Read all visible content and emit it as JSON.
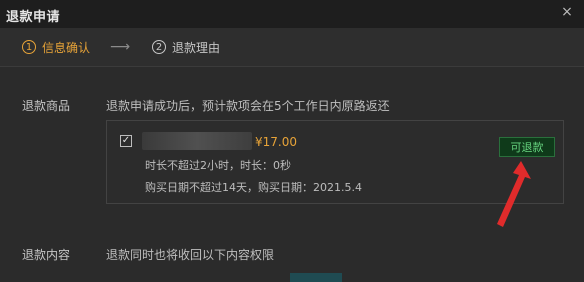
{
  "window": {
    "title": "退款申请",
    "close_icon": "×"
  },
  "steps": [
    {
      "number": "1",
      "label": "信息确认",
      "active": true,
      "color": "#e7a338"
    },
    {
      "number": "2",
      "label": "退款理由",
      "active": false
    }
  ],
  "step_arrow": "⟶",
  "section_goods": {
    "label": "退款商品",
    "description": "退款申请成功后，预计款项会在5个工作日内原路返还"
  },
  "item": {
    "checked": true,
    "price": "¥17.00",
    "duration_line": "时长不超过2小时，时长：0秒",
    "date_line": "购买日期不超过14天，购买日期：2021.5.4",
    "status_button": "可退款",
    "status_color": "#66d37f"
  },
  "section_content": {
    "label": "退款内容",
    "description": "退款同时也将收回以下内容权限"
  },
  "colors": {
    "accent": "#e7a338",
    "annotation_arrow": "#e02b2b"
  }
}
